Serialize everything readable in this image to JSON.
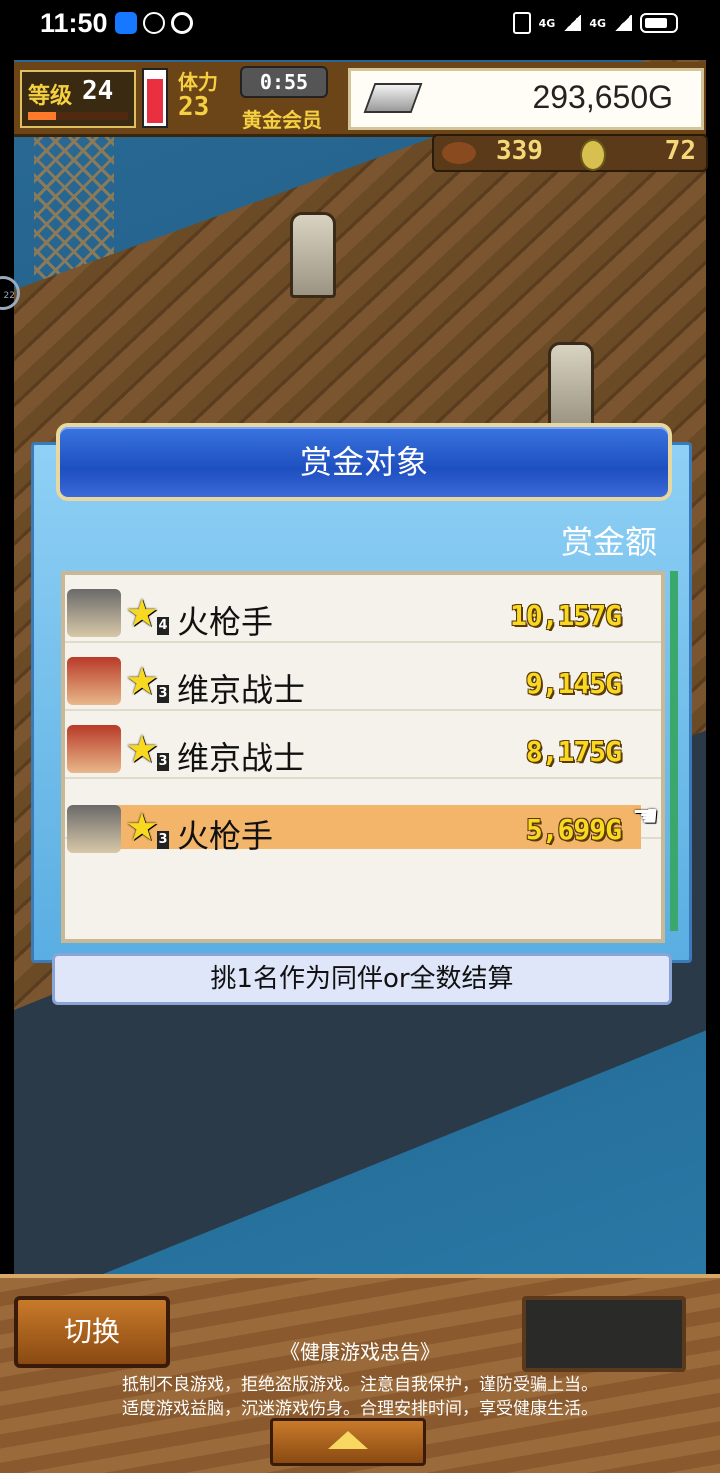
{
  "status": {
    "time": "11:50",
    "net1": "4G",
    "net2": "4G"
  },
  "hud": {
    "level_label": "等级",
    "level": "24",
    "level_progress": 0.28,
    "hp_level": 0.8,
    "stamina_label": "体力",
    "stamina": "23",
    "timer": "0:55",
    "member": "黄金会员",
    "gold": "293,650G",
    "food": "339",
    "medals": "72"
  },
  "dialog": {
    "title": "赏金对象",
    "bounty_header": "赏金额",
    "rows": [
      {
        "name": "火枪手",
        "rank": "4",
        "value": "10,157G",
        "avatar": "gunner",
        "selected": false
      },
      {
        "name": "维京战士",
        "rank": "3",
        "value": "9,145G",
        "avatar": "viking",
        "selected": false
      },
      {
        "name": "维京战士",
        "rank": "3",
        "value": "8,175G",
        "avatar": "viking",
        "selected": false
      },
      {
        "name": "火枪手",
        "rank": "3",
        "value": "5,699G",
        "avatar": "gunner",
        "selected": true
      }
    ],
    "instruction": "挑1名作为同伴or全数结算"
  },
  "bottom": {
    "switch_label": "切换",
    "notice_title": "《健康游戏忠告》",
    "notice_line1": "抵制不良游戏，拒绝盗版游戏。注意自我保护，谨防受骗上当。",
    "notice_line2": "适度游戏益脑，沉迷游戏伤身。合理安排时间，享受健康生活。"
  },
  "icons": [
    "alipay-icon",
    "speed-icon",
    "alarm-icon",
    "vibrate-icon",
    "signal-icon",
    "battery-icon",
    "silver-ingot-icon",
    "meat-icon",
    "medal-icon",
    "star-icon",
    "hand-pointer-icon",
    "up-arrow-icon"
  ]
}
